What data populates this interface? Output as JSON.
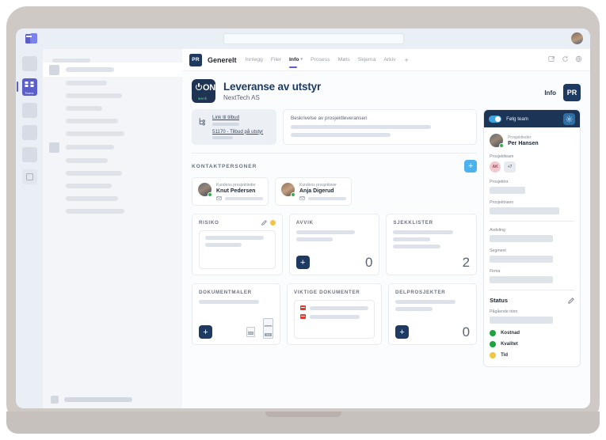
{
  "window": {
    "app_name": "Microsoft Teams",
    "search_placeholder": ""
  },
  "rail": {
    "items": [
      {
        "name": "rail-item-1",
        "label": ""
      },
      {
        "name": "rail-item-teams",
        "label": "Teams",
        "active": true
      },
      {
        "name": "rail-item-3",
        "label": ""
      },
      {
        "name": "rail-item-4",
        "label": ""
      },
      {
        "name": "rail-item-5",
        "label": ""
      },
      {
        "name": "rail-item-apps",
        "label": ""
      }
    ]
  },
  "tabstrip": {
    "team_badge": "PR",
    "team_name": "Generelt",
    "tabs": [
      {
        "label": "Innlegg",
        "active": false
      },
      {
        "label": "Filer",
        "active": false
      },
      {
        "label": "Info",
        "active": true,
        "has_caret": true
      },
      {
        "label": "Prosess",
        "active": false
      },
      {
        "label": "Møts",
        "active": false
      },
      {
        "label": "Skjema",
        "active": false
      },
      {
        "label": "Arkiv",
        "active": false
      }
    ],
    "add_tab": "+",
    "icons": [
      "popout-icon",
      "refresh-icon",
      "globe-icon"
    ]
  },
  "header": {
    "logo_mark": "ON",
    "logo_sub": "work",
    "title": "Leveranse av utstyr",
    "subtitle": "NextTech AS",
    "info_label": "Info",
    "pr_badge": "PR"
  },
  "tilbud": {
    "link_label": "Link til tilbud",
    "offer_label": "51170 - Tilbud på utstyr",
    "description_title": "Beskrivelse av prosjektleveransen"
  },
  "contacts": {
    "section_title": "KONTAKTPERSONER",
    "add_label": "+",
    "people": [
      {
        "role": "Kundens prosjektleder",
        "name": "Knut Pedersen"
      },
      {
        "role": "Kundens prosjekteier",
        "name": "Anja Digerud"
      }
    ]
  },
  "tiles": [
    {
      "title": "RISIKO",
      "count": null,
      "add": null,
      "edit": true,
      "status_color": "#f3c544"
    },
    {
      "title": "AVVIK",
      "count": "0",
      "add": "+",
      "edit": false,
      "status_color": null
    },
    {
      "title": "SJEKKLISTER",
      "count": "2",
      "add": null,
      "edit": false,
      "status_color": null
    },
    {
      "title": "DOKUMENTMALER",
      "count": null,
      "add": "+",
      "edit": false,
      "status_color": null
    },
    {
      "title": "VIKTIGE DOKUMENTER",
      "count": null,
      "add": null,
      "edit": false,
      "status_color": null
    },
    {
      "title": "DELPROSJEKTER",
      "count": "0",
      "add": "+",
      "edit": false,
      "status_color": null
    }
  ],
  "file_icons": [
    "PPT",
    "DOC",
    "XLS"
  ],
  "side": {
    "follow_label": "Følg team",
    "gear": "gear-icon",
    "manager_role": "Prosjektleder",
    "manager_name": "Per Hansen",
    "team_label": "Prosjektteam",
    "team_chip": "AK",
    "team_more": "+7",
    "fields": [
      {
        "label": "Prosjektnr."
      },
      {
        "label": "Prosjektnavn"
      },
      {
        "label": "Avdeling"
      },
      {
        "label": "Segment"
      },
      {
        "label": "Firma"
      }
    ],
    "status_title": "Status",
    "status_edit": "pencil-icon",
    "step_label": "Pågående trinn",
    "indicators": [
      {
        "label": "Kostnad",
        "color": "#1fa33f"
      },
      {
        "label": "Kvalitet",
        "color": "#1fa33f"
      },
      {
        "label": "Tid",
        "color": "#f3c544"
      }
    ]
  },
  "colors": {
    "navy": "#1f3a60",
    "teams_purple": "#5b5fc7",
    "accent_blue": "#4db1ee",
    "green": "#1fa33f",
    "yellow": "#f3c544"
  }
}
